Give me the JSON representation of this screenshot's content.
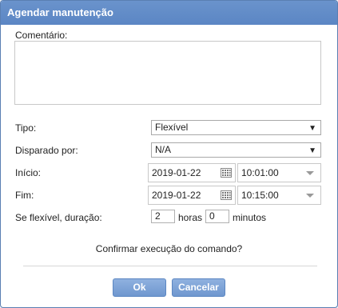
{
  "dialog": {
    "title": "Agendar manutenção"
  },
  "form": {
    "comment_label": "Comentário:",
    "comment_value": "",
    "type_label": "Tipo:",
    "type_value": "Flexível",
    "triggered_by_label": "Disparado por:",
    "triggered_by_value": "N/A",
    "start_label": "Início:",
    "start_date": "2019-01-22",
    "start_time": "10:01:00",
    "end_label": "Fim:",
    "end_date": "2019-01-22",
    "end_time": "10:15:00",
    "duration_label": "Se flexível, duração:",
    "duration_hours": "2",
    "hours_label": "horas",
    "duration_minutes": "0",
    "minutes_label": "minutos"
  },
  "confirm_text": "Confirmar execução do comando?",
  "buttons": {
    "ok": "Ok",
    "cancel": "Cancelar"
  },
  "icons": {
    "dropdown": "dropdown-arrow-icon",
    "calendar": "calendar-icon",
    "time_dropdown": "chevron-down-icon"
  },
  "colors": {
    "titlebar": "#5b86c4",
    "button": "#7a9fd4"
  }
}
